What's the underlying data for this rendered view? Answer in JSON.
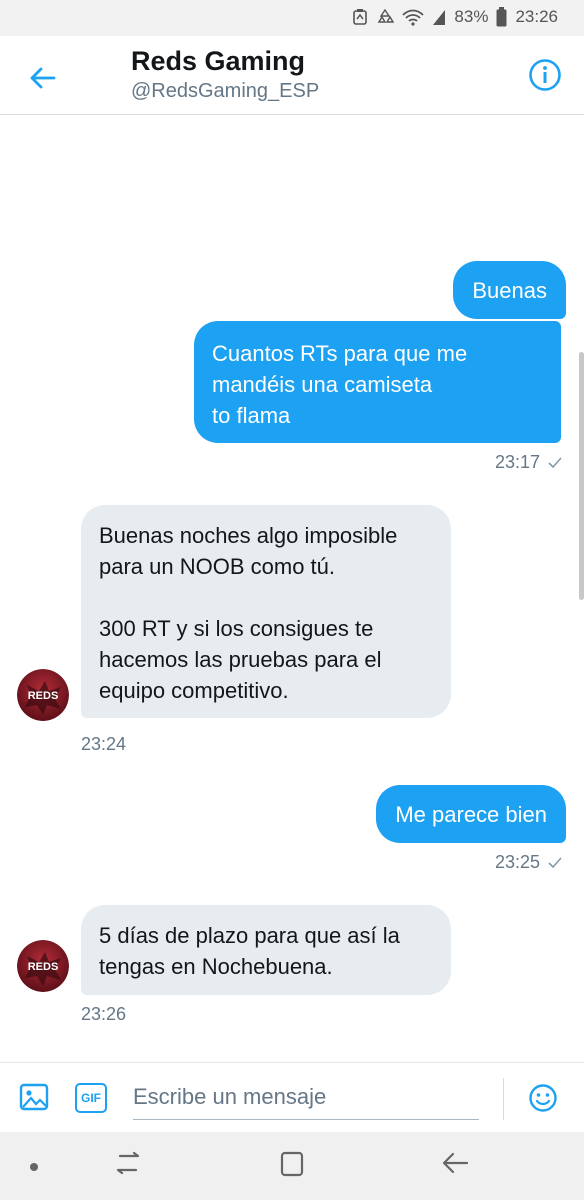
{
  "status_bar": {
    "battery": "83%",
    "time": "23:26"
  },
  "header": {
    "title": "Reds Gaming",
    "handle": "@RedsGaming_ESP"
  },
  "messages": [
    {
      "text": "Buenas"
    },
    {
      "text": "Cuantos RTs para que me\nmandéis una camiseta\nto flama",
      "time": "23:17"
    },
    {
      "text": "Buenas noches algo imposible\npara un NOOB como tú.\n\n300 RT y si los consigues te\nhacemos las pruebas para el\nequipo competitivo.",
      "time": "23:24"
    },
    {
      "text": "Me parece bien",
      "time": "23:25"
    },
    {
      "text": "5 días de plazo para que así la\ntengas en Nochebuena.",
      "time": "23:26"
    }
  ],
  "avatar": {
    "text": "REDS"
  },
  "composer": {
    "gif_label": "GIF",
    "placeholder": "Escribe un mensaje"
  },
  "colors": {
    "accent": "#1da1f2",
    "incoming_bubble": "#e6ecf0",
    "brand_red": "#8b1a24"
  }
}
